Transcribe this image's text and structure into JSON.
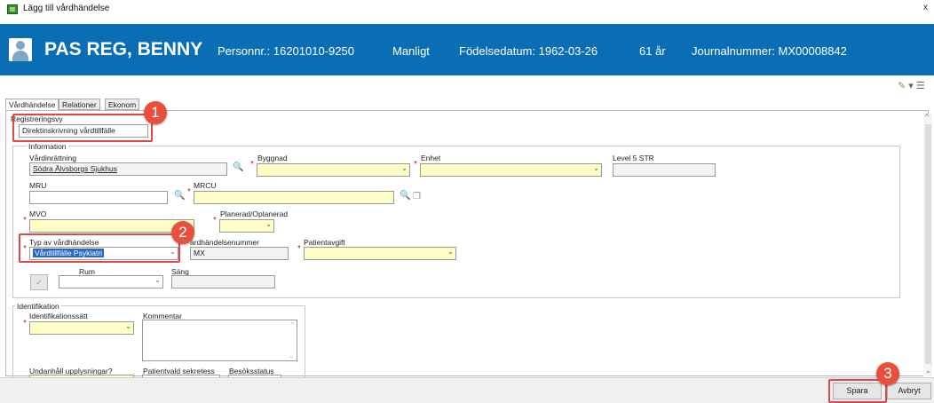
{
  "window": {
    "title": "Lägg till vårdhändelse",
    "close_glyph": "x"
  },
  "patient": {
    "name": "PAS REG, BENNY",
    "personnr": "Personnr.: 16201010-9250",
    "gender": "Manligt",
    "birthdate": "Födelsedatum: 1962-03-26",
    "age": "61 år",
    "journal": "Journalnummer: MX00008842"
  },
  "tabs": [
    "Vårdhändelse",
    "Relationer",
    "Ekonom"
  ],
  "registration": {
    "label": "Registreringsvy",
    "value": "Direktinskrivning vårdtillfälle"
  },
  "information": {
    "title": "Information",
    "vardinrattning_label": "Vårdinrättning",
    "vardinrattning_value": "Södra Älvsborgs Sjukhus",
    "byggnad_label": "Byggnad",
    "enhet_label": "Enhet",
    "level5_label": "Level 5 STR",
    "mru_label": "MRU",
    "mrcu_label": "MRCU",
    "mvo_label": "MVO",
    "planerad_label": "Planerad/Oplanerad",
    "typ_label": "Typ av vårdhändelse",
    "typ_value": "Vårdtillfälle Psykiatri",
    "vhnr_label": "ardhändelsenummer",
    "vhnr_value": "MX",
    "patientavgift_label": "Patientavgift",
    "rum_label": "Rum",
    "sang_label": "Säng"
  },
  "identification": {
    "title": "Identifikation",
    "method_label": "Identifikationssätt",
    "comment_label": "Kommentar",
    "withheld_label": "Undanhåll upplysningar?",
    "confidentiality_label": "Patientvald sekretess",
    "visit_status_label": "Besöksstatus"
  },
  "buttons": {
    "save": "Spara",
    "cancel": "Avbryt"
  },
  "badges": [
    "1",
    "2",
    "3"
  ],
  "colors": {
    "header": "#0a6eb4",
    "required": "#fdfdc6",
    "highlight": "#e04848",
    "badge": "#e84f3d"
  }
}
